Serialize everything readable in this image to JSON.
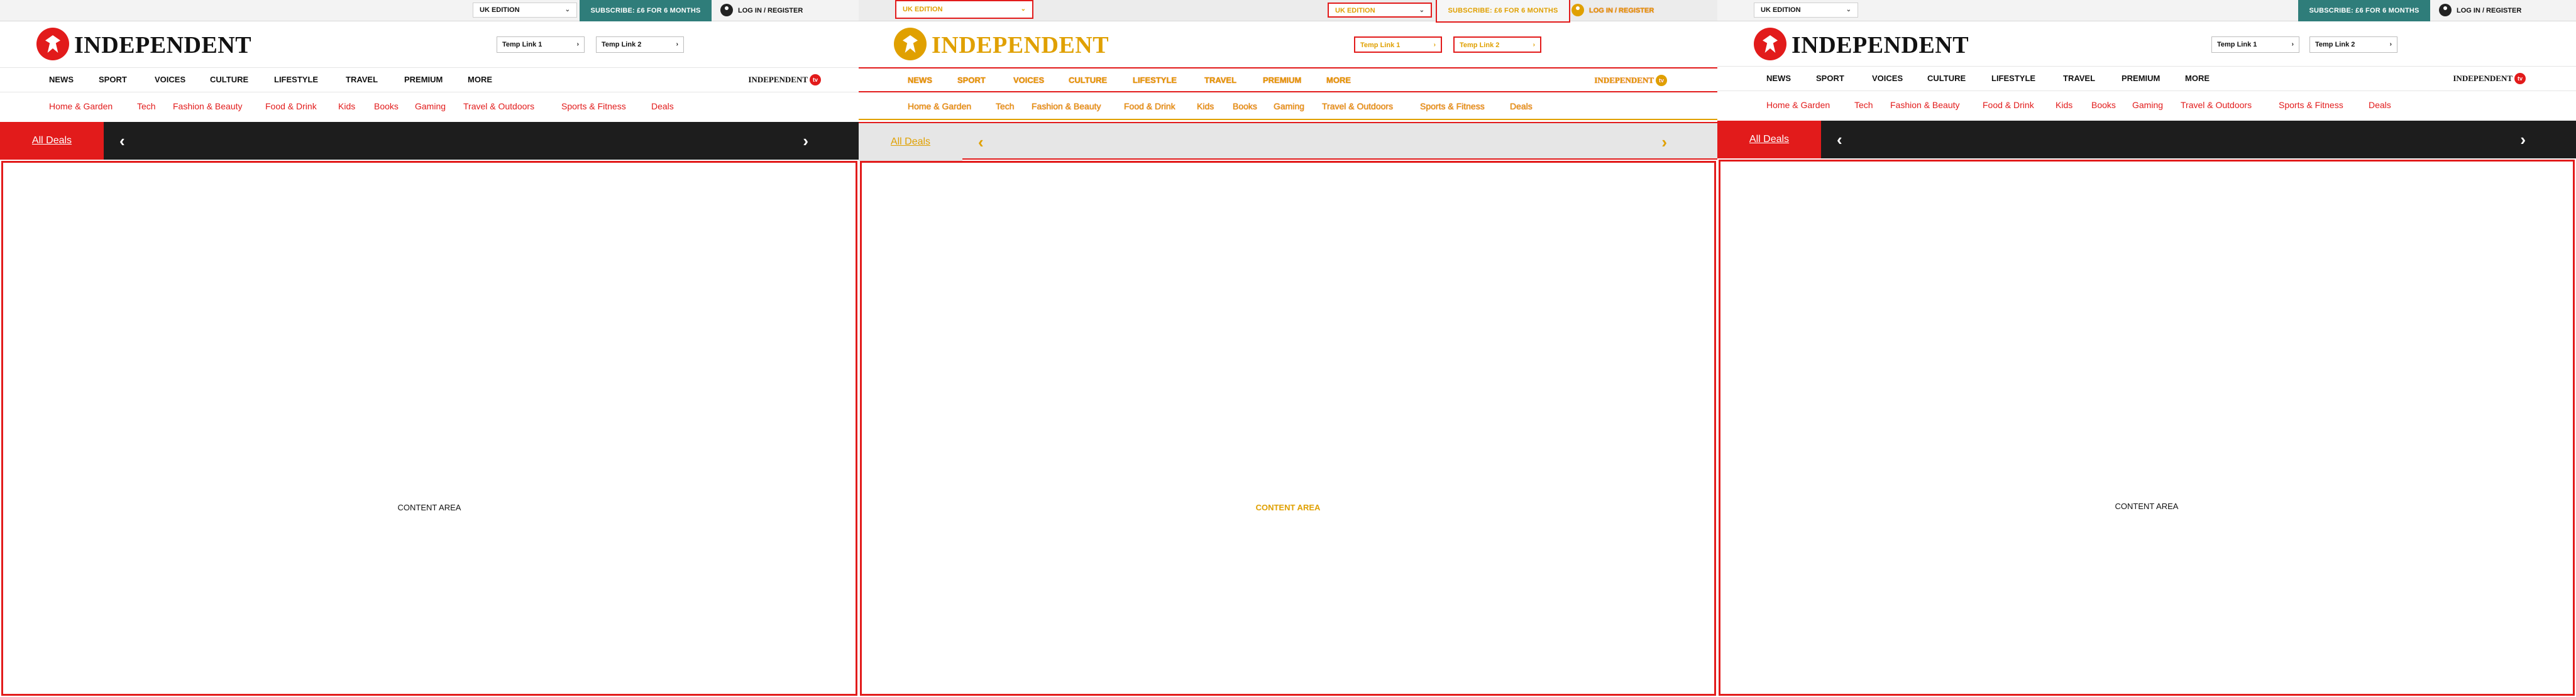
{
  "header": {
    "edition_label": "UK EDITION",
    "subscribe_label": "SUBSCRIBE: £6 FOR 6 MONTHS",
    "login_label": "LOG IN / REGISTER",
    "logo_text": "INDEPENDENT",
    "temp_link_1": "Temp Link 1",
    "temp_link_2": "Temp Link 2",
    "chevron_down": "⌄",
    "chevron_right": "›"
  },
  "main_nav": [
    "NEWS",
    "SPORT",
    "VOICES",
    "CULTURE",
    "LIFESTYLE",
    "TRAVEL",
    "PREMIUM",
    "MORE"
  ],
  "tv_label": "INDEPENDENT",
  "tv_badge": "tv",
  "sub_nav": [
    "Home & Garden",
    "Tech",
    "Fashion & Beauty",
    "Food & Drink",
    "Kids",
    "Books",
    "Gaming",
    "Travel & Outdoors",
    "Sports & Fitness",
    "Deals"
  ],
  "deals": {
    "all_deals_label": "All Deals",
    "prev_arrow": "‹",
    "next_arrow": "›"
  },
  "content_label": "CONTENT AREA",
  "colors": {
    "brand_red": "#e21b1b",
    "subscribe_teal": "#2f7d7a",
    "deals_bar": "#1d1d1d",
    "overlay_highlight": "#e0a000"
  }
}
